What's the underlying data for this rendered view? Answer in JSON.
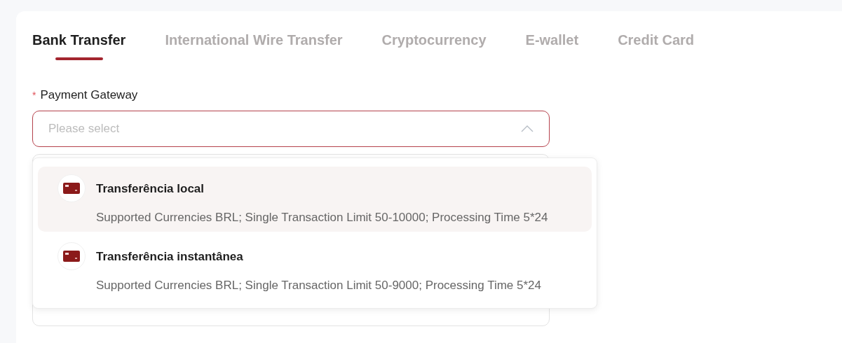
{
  "tabs": [
    {
      "label": "Bank Transfer",
      "selected": true
    },
    {
      "label": "International Wire Transfer",
      "selected": false
    },
    {
      "label": "Cryptocurrency",
      "selected": false
    },
    {
      "label": "E-wallet",
      "selected": false
    },
    {
      "label": "Credit Card",
      "selected": false
    }
  ],
  "payment_gateway": {
    "label": "Payment Gateway",
    "required_mark": "*",
    "placeholder": "Please select",
    "expanded": true,
    "options": [
      {
        "title": "Transferência local",
        "description": "Supported Currencies BRL; Single Transaction Limit 50-10000; Processing Time 5*24",
        "selected": true
      },
      {
        "title": "Transferência instantânea",
        "description": "Supported Currencies BRL; Single Transaction Limit 50-9000; Processing Time 5*24",
        "selected": false
      }
    ]
  }
}
